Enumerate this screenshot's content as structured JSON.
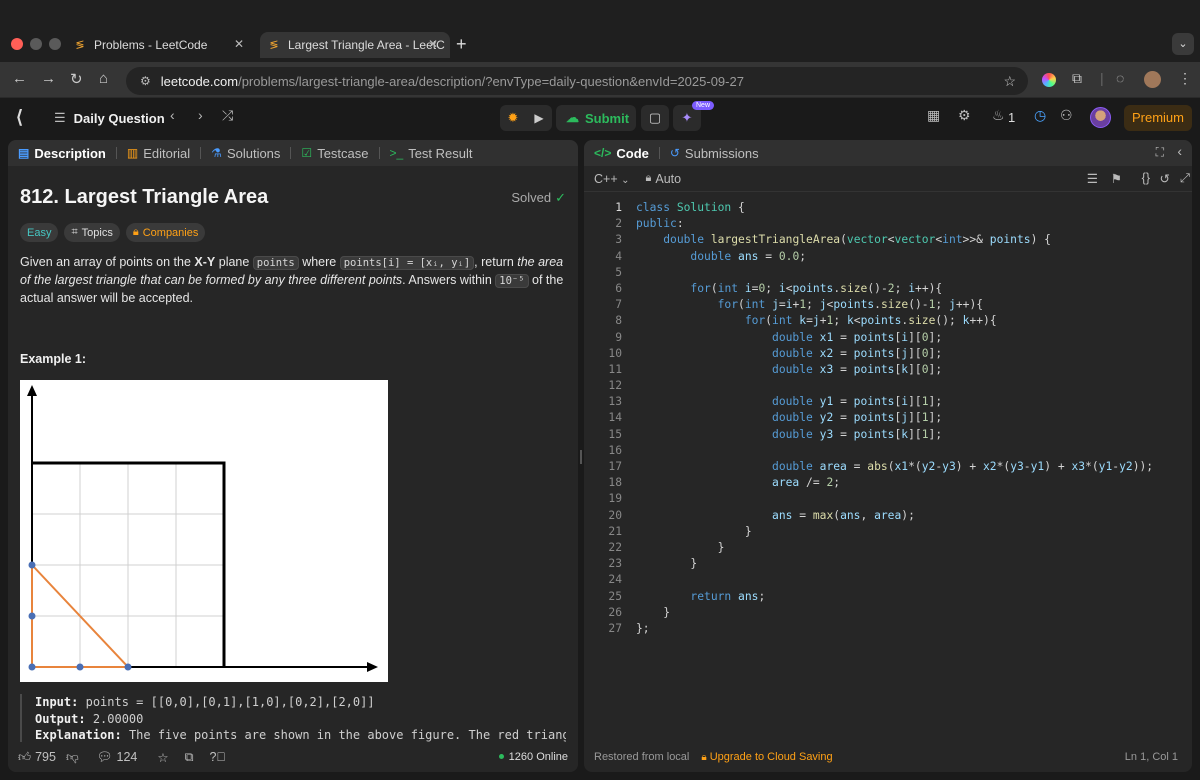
{
  "browser": {
    "tabs": [
      {
        "title": "Problems - LeetCode"
      },
      {
        "title": "Largest Triangle Area - LeetC"
      }
    ],
    "url_host": "leetcode.com",
    "url_path": "/problems/largest-triangle-area/description/?envType=daily-question&envId=2025-09-27"
  },
  "header": {
    "daily_label": "Daily Question",
    "submit_label": "Submit",
    "new_badge": "New",
    "streak_count": "1",
    "premium_label": "Premium"
  },
  "left_tabs": [
    {
      "label": "Description"
    },
    {
      "label": "Editorial"
    },
    {
      "label": "Solutions"
    },
    {
      "label": "Testcase"
    },
    {
      "label": "Test Result"
    }
  ],
  "problem": {
    "title": "812. Largest Triangle Area",
    "status": "Solved",
    "difficulty": "Easy",
    "topics_label": "Topics",
    "companies_label": "Companies",
    "desc_1": "Given an array of points on the ",
    "desc_xy": "X-Y",
    "desc_2": " plane ",
    "code_points": "points",
    "desc_3": " where ",
    "code_pointi": "points[i] = [xᵢ, yᵢ]",
    "desc_4": ", return ",
    "desc_italic": "the area of the largest triangle that can be formed by any three different points",
    "desc_5": ". Answers within ",
    "code_tol": "10⁻⁵",
    "desc_6": " of the actual answer will be accepted.",
    "example_title": "Example 1:",
    "input_label": "Input:",
    "input_value": "points = [[0,0],[0,1],[1,0],[0,2],[2,0]]",
    "output_label": "Output:",
    "output_value": "2.00000",
    "explanation_label": "Explanation:",
    "explanation_value": "The five points are shown in the above figure. The red triangle"
  },
  "left_footer": {
    "likes": "795",
    "comments": "124",
    "online": "1260 Online"
  },
  "code_panel": {
    "code_tab": "Code",
    "submissions_tab": "Submissions",
    "language": "C++",
    "mode": "Auto",
    "restored": "Restored from local",
    "upgrade": "Upgrade to Cloud Saving",
    "cursor": "Ln 1, Col 1"
  },
  "colors": {
    "accent_green": "#2cbb5d",
    "accent_orange": "#ffa116",
    "easy_teal": "#46c6c2"
  }
}
